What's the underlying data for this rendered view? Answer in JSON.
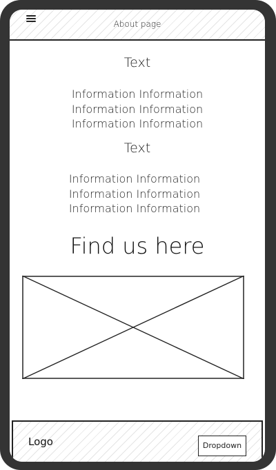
{
  "header": {
    "title": "About page",
    "menu_icon": "hamburger-menu-icon"
  },
  "sections": [
    {
      "title": "Text",
      "lines": [
        "Information Information",
        "Information Information",
        "Information Information"
      ]
    },
    {
      "title": "Text",
      "lines": [
        "Information Information",
        "Information Information",
        "Information Information"
      ]
    }
  ],
  "find_us": {
    "heading": "Find us here",
    "map_icon": "image-placeholder-icon"
  },
  "footer": {
    "logo": "Logo",
    "dropdown_label": "Dropdown"
  },
  "colors": {
    "frame": "#343434",
    "stroke": "#222222",
    "hatch": "#e4e4e4"
  }
}
